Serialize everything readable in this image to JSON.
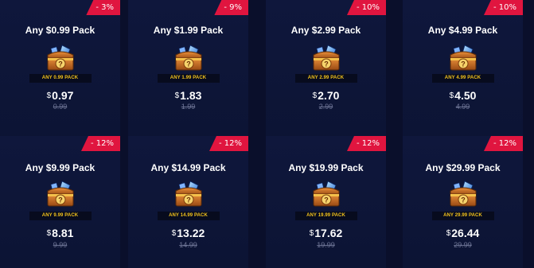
{
  "cards": [
    {
      "discount": "- 3%",
      "title": "Any $0.99 Pack",
      "pack_label": "ANY 0.99 PACK",
      "currency": "$",
      "price": "0.97",
      "old_price": "0.99"
    },
    {
      "discount": "- 9%",
      "title": "Any $1.99 Pack",
      "pack_label": "ANY 1.99 PACK",
      "currency": "$",
      "price": "1.83",
      "old_price": "1.99"
    },
    {
      "discount": "- 10%",
      "title": "Any $2.99 Pack",
      "pack_label": "ANY 2.99 PACK",
      "currency": "$",
      "price": "2.70",
      "old_price": "2.99"
    },
    {
      "discount": "- 10%",
      "title": "Any $4.99 Pack",
      "pack_label": "ANY 4.99 PACK",
      "currency": "$",
      "price": "4.50",
      "old_price": "4.99"
    },
    {
      "discount": "- 12%",
      "title": "Any $9.99 Pack",
      "pack_label": "ANY 9.99 PACK",
      "currency": "$",
      "price": "8.81",
      "old_price": "9.99"
    },
    {
      "discount": "- 12%",
      "title": "Any $14.99 Pack",
      "pack_label": "ANY 14.99 PACK",
      "currency": "$",
      "price": "13.22",
      "old_price": "14.99"
    },
    {
      "discount": "- 12%",
      "title": "Any $19.99 Pack",
      "pack_label": "ANY 19.99 PACK",
      "currency": "$",
      "price": "17.62",
      "old_price": "19.99"
    },
    {
      "discount": "- 12%",
      "title": "Any $29.99 Pack",
      "pack_label": "ANY 29.99 PACK",
      "currency": "$",
      "price": "26.44",
      "old_price": "29.99"
    }
  ],
  "icons": {
    "pack": "mystery-chest-icon"
  },
  "colors": {
    "badge": "#e0153f",
    "background": "#0a0f2b",
    "card": "#0d1536",
    "pack_label_text": "#f2c21b",
    "old_price": "#6e7596"
  }
}
